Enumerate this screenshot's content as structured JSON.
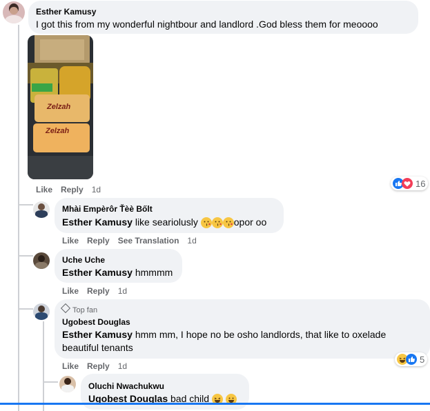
{
  "comments": [
    {
      "author": "Esther Kamusy",
      "text": "I got this from my wonderful nightbour and landlord .God bless them for meoooo",
      "actions": {
        "like": "Like",
        "reply": "Reply",
        "time": "1d"
      },
      "reactions": {
        "count": "16",
        "icons": [
          "like-icon",
          "love-icon"
        ]
      },
      "photo_labels": [
        "Zelzah",
        "Zelzah"
      ]
    },
    {
      "author": "Mhài Empèrôr Ťèè Bőlt",
      "mention": "Esther Kamusy",
      "text": "like seariolusly",
      "text_after": "opor oo",
      "actions": {
        "like": "Like",
        "reply": "Reply",
        "translate": "See Translation",
        "time": "1d"
      }
    },
    {
      "author": "Uche Uche",
      "mention": "Esther Kamusy",
      "text": "hmmmm",
      "actions": {
        "like": "Like",
        "reply": "Reply",
        "time": "1d"
      }
    },
    {
      "badge": "Top fan",
      "author": "Ugobest Douglas",
      "mention": "Esther Kamusy",
      "text": "hmm mm, I hope no be osho landlords, that like to oxelade",
      "text_line2": "beautiful tenants",
      "actions": {
        "like": "Like",
        "reply": "Reply",
        "time": "1d"
      },
      "reactions": {
        "count": "5",
        "icons": [
          "haha-icon",
          "like-icon"
        ]
      }
    },
    {
      "author": "Oluchi Nwachukwu",
      "mention": "Ugobest Douglas",
      "text": "bad child"
    }
  ],
  "colors": {
    "bubble": "#f0f2f5",
    "meta": "#65676b",
    "like_blue": "#1877f2",
    "love_red": "#f33e58"
  }
}
